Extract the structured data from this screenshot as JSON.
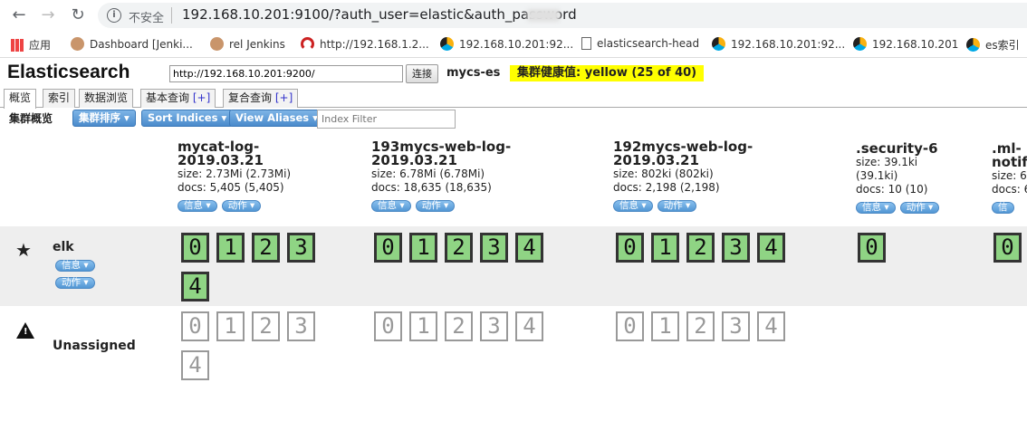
{
  "browser": {
    "insecure_label": "不安全",
    "url": "192.168.10.201:9100/?auth_user=elastic&auth_password",
    "bookmarks": [
      {
        "label": "应用",
        "icon": "apps-grid-icon"
      },
      {
        "label": "Dashboard [Jenki...",
        "icon": "jenkins-icon"
      },
      {
        "label": "rel Jenkins",
        "icon": "jenkins-icon"
      },
      {
        "label": "http://192.168.1.2...",
        "icon": "arc-icon"
      },
      {
        "label": "192.168.10.201:92...",
        "icon": "elastic-icon"
      },
      {
        "label": "elasticsearch-head",
        "icon": "page-icon"
      },
      {
        "label": "192.168.10.201:92...",
        "icon": "elastic-icon"
      },
      {
        "label": "192.168.10.201",
        "icon": "elastic-icon"
      },
      {
        "label": "es索引",
        "icon": "elastic-icon"
      }
    ]
  },
  "header": {
    "title": "Elasticsearch",
    "connect_url": "http://192.168.10.201:9200/",
    "connect_label": "连接",
    "cluster_name": "mycs-es",
    "health": "集群健康值: yellow (25 of 40)",
    "health_color": "#ffff00"
  },
  "tabs": [
    {
      "label": "概览",
      "plus": ""
    },
    {
      "label": "索引",
      "plus": ""
    },
    {
      "label": "数据浏览",
      "plus": ""
    },
    {
      "label": "基本查询",
      "plus": "[+]"
    },
    {
      "label": "复合查询",
      "plus": "[+]"
    }
  ],
  "toolbar": {
    "label": "集群概览",
    "sort_cluster": "集群排序",
    "sort_indices": "Sort Indices",
    "view_aliases": "View Aliases",
    "filter_placeholder": "Index Filter"
  },
  "indices": [
    {
      "name1": "mycat-log-",
      "name2": "2019.03.21",
      "size": "size: 2.73Mi (2.73Mi)",
      "docs": "docs: 5,405 (5,405)",
      "info": "信息",
      "action": "动作"
    },
    {
      "name1": "193mycs-web-log-",
      "name2": "2019.03.21",
      "size": "size: 6.78Mi (6.78Mi)",
      "docs": "docs: 18,635 (18,635)",
      "info": "信息",
      "action": "动作"
    },
    {
      "name1": "192mycs-web-log-",
      "name2": "2019.03.21",
      "size": "size: 802ki (802ki)",
      "docs": "docs: 2,198 (2,198)",
      "info": "信息",
      "action": "动作"
    },
    {
      "name1": ".security-6",
      "name2": "",
      "size": "size: 39.1ki",
      "size2": "(39.1ki)",
      "docs": "docs: 10 (10)",
      "info": "信息",
      "action": "动作"
    },
    {
      "name1": ".ml-",
      "name2": "notif",
      "size": "size: 6",
      "docs": "docs: 6",
      "info": "信",
      "action": ""
    }
  ],
  "nodes": {
    "elk": {
      "name": "elk",
      "info": "信息",
      "action": "动作"
    },
    "unassigned": {
      "name": "Unassigned"
    }
  },
  "shards": {
    "elk_mycat": [
      "0",
      "1",
      "2",
      "3",
      "4"
    ],
    "elk_193": [
      "0",
      "1",
      "2",
      "3",
      "4"
    ],
    "elk_192": [
      "0",
      "1",
      "2",
      "3",
      "4"
    ],
    "elk_security": [
      "0"
    ],
    "elk_ml": [
      "0"
    ],
    "un_mycat": [
      "0",
      "1",
      "2",
      "3",
      "4"
    ],
    "un_193": [
      "0",
      "1",
      "2",
      "3",
      "4"
    ],
    "un_192": [
      "0",
      "1",
      "2",
      "3",
      "4"
    ]
  }
}
